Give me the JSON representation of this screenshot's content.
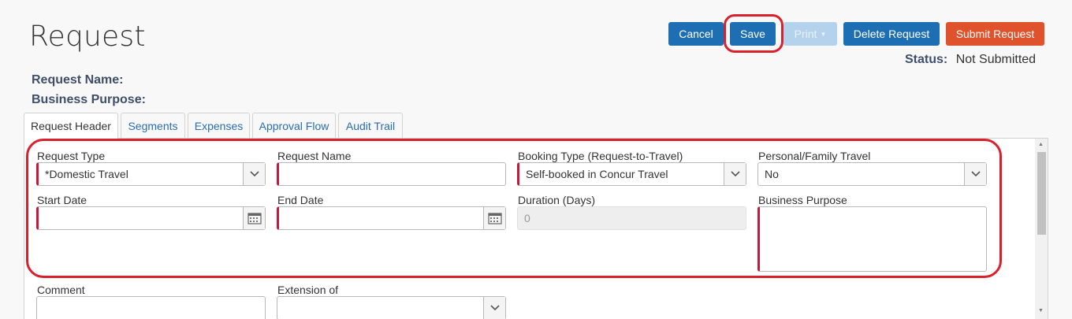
{
  "page": {
    "title": "Request"
  },
  "toolbar": {
    "cancel": "Cancel",
    "save": "Save",
    "print": "Print",
    "delete": "Delete Request",
    "submit": "Submit Request"
  },
  "status": {
    "label": "Status:",
    "value": "Not Submitted"
  },
  "summary": {
    "name_label": "Request Name:",
    "purpose_label": "Business Purpose:"
  },
  "tabs": [
    "Request Header",
    "Segments",
    "Expenses",
    "Approval Flow",
    "Audit Trail"
  ],
  "form": {
    "request_type": {
      "label": "Request Type",
      "value": "*Domestic Travel"
    },
    "request_name": {
      "label": "Request Name",
      "value": ""
    },
    "booking_type": {
      "label": "Booking Type (Request-to-Travel)",
      "value": "Self-booked in Concur Travel"
    },
    "personal_travel": {
      "label": "Personal/Family Travel",
      "value": "No"
    },
    "start_date": {
      "label": "Start Date",
      "value": ""
    },
    "end_date": {
      "label": "End Date",
      "value": ""
    },
    "duration": {
      "label": "Duration (Days)",
      "value": "0"
    },
    "business_purpose": {
      "label": "Business Purpose",
      "value": ""
    },
    "comment": {
      "label": "Comment",
      "value": ""
    },
    "extension_of": {
      "label": "Extension of",
      "value": ""
    }
  },
  "colors": {
    "primary": "#1d6eb3",
    "submit": "#e0522b",
    "required": "#c4193b",
    "highlight": "#d9212d"
  },
  "icons": {
    "dropdown": "chevron-down-icon",
    "calendar": "calendar-icon"
  }
}
